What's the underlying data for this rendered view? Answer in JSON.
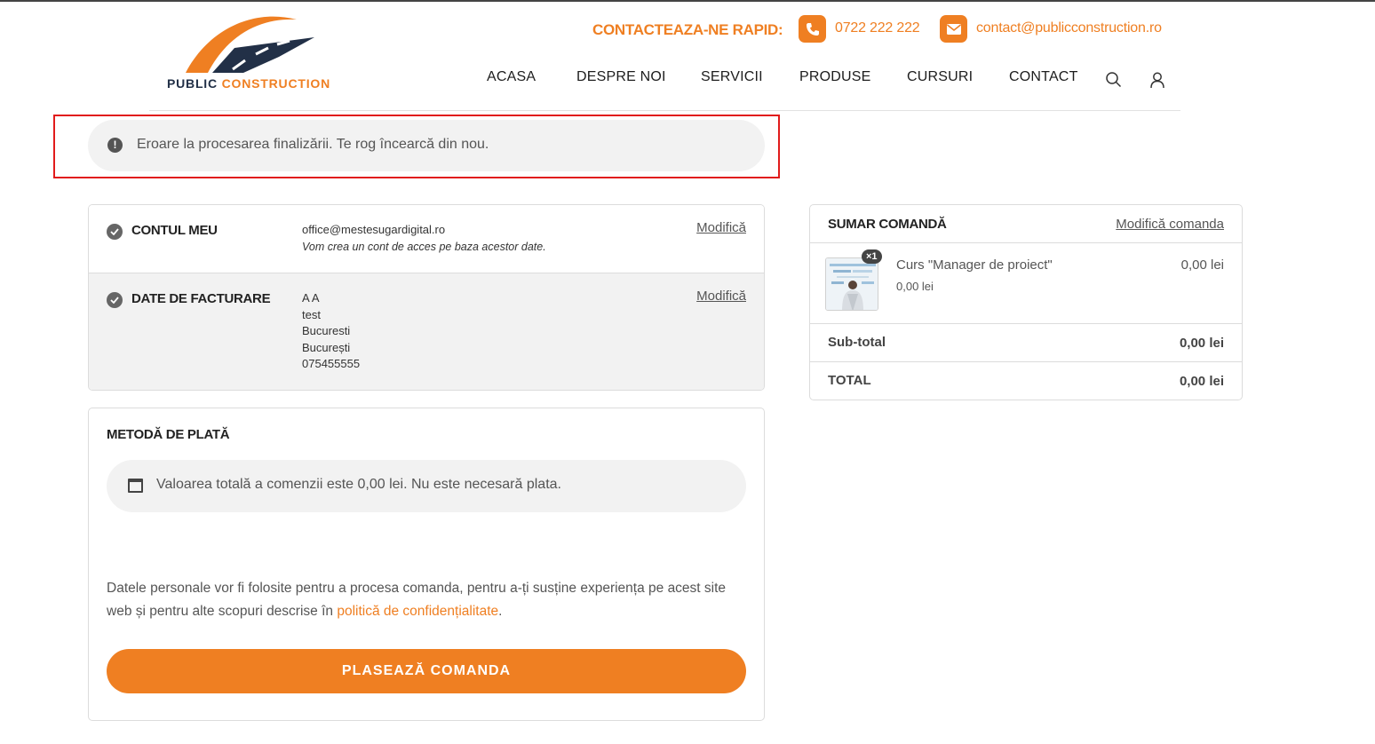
{
  "header": {
    "logo": {
      "word1": "PUBLIC",
      "word2": "CONSTRUCTION"
    },
    "contact_label": "CONTACTEAZA-NE RAPID:",
    "phone": "0722 222 222",
    "email": "contact@publicconstruction.ro",
    "nav": [
      "ACASA",
      "DESPRE NOI",
      "SERVICII",
      "PRODUSE",
      "CURSURI",
      "CONTACT"
    ],
    "icons": [
      "search-icon",
      "user-icon"
    ]
  },
  "notice": {
    "type": "error",
    "message": "Eroare la procesarea finalizării. Te rog încearcă din nou."
  },
  "account": {
    "title": "CONTUL MEU",
    "email": "office@mestesugardigital.ro",
    "note": "Vom crea un cont de acces pe baza acestor date.",
    "modify_label": "Modifică"
  },
  "billing": {
    "title": "DATE DE FACTURARE",
    "lines": [
      "A A",
      "test",
      "Bucuresti",
      "București",
      "075455555"
    ],
    "modify_label": "Modifică"
  },
  "payment": {
    "title": "METODĂ DE PLATĂ",
    "info": "Valoarea totală a comenzii este 0,00 lei. Nu este necesară plata.",
    "privacy_text_before": "Datele personale vor fi folosite pentru a procesa comanda, pentru a-ți susține experiența pe acest site web și pentru alte scopuri descrise în ",
    "privacy_link": "politică de confidențialitate",
    "privacy_text_after": ".",
    "place_order_label": "PLASEAZĂ COMANDA"
  },
  "summary": {
    "title": "SUMAR COMANDĂ",
    "edit_label": "Modifică comanda",
    "items": [
      {
        "name": "Curs \"Manager de proiect\"",
        "quantity": "×1",
        "unit_price": "0,00 lei",
        "price": "0,00 lei"
      }
    ],
    "subtotal_label": "Sub-total",
    "subtotal": "0,00 lei",
    "total_label": "TOTAL",
    "total": "0,00 lei"
  },
  "colors": {
    "accent": "#ef7f22",
    "navy": "#223047",
    "error_outline": "#e11b1b",
    "panel": "#f2f2f2"
  }
}
